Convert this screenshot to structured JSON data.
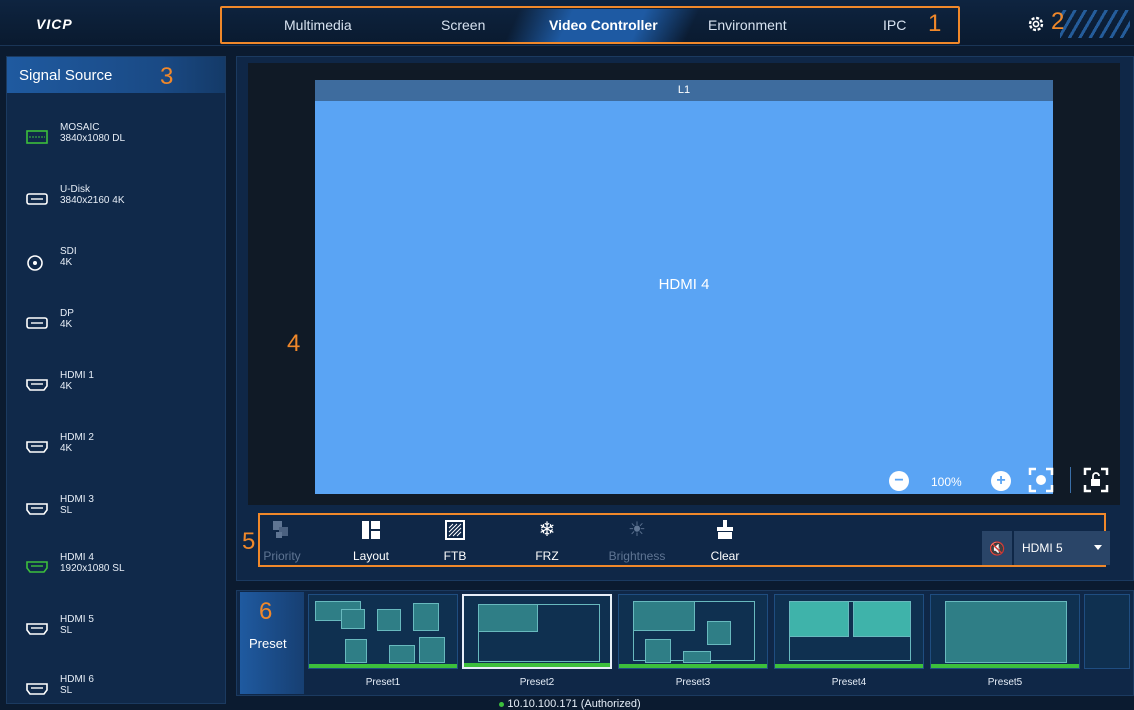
{
  "app": {
    "logo": "VICP"
  },
  "nav": {
    "tabs": [
      {
        "label": "Multimedia"
      },
      {
        "label": "Screen"
      },
      {
        "label": "Video Controller",
        "active": true
      },
      {
        "label": "Environment"
      },
      {
        "label": "IPC"
      }
    ]
  },
  "callouts": {
    "c1": "1",
    "c2": "2",
    "c3": "3",
    "c4": "4",
    "c5": "5",
    "c6": "6"
  },
  "sidebar": {
    "title": "Signal Source",
    "items": [
      {
        "name": "MOSAIC",
        "res": "3840x1080 DL",
        "icon": "mosaic-icon"
      },
      {
        "name": "U-Disk",
        "res": "3840x2160 4K",
        "icon": "usb-disk-icon"
      },
      {
        "name": "SDI",
        "res": "4K",
        "icon": "sdi-icon"
      },
      {
        "name": "DP",
        "res": "4K",
        "icon": "displayport-icon"
      },
      {
        "name": "HDMI 1",
        "res": "4K",
        "icon": "hdmi-icon"
      },
      {
        "name": "HDMI 2",
        "res": "4K",
        "icon": "hdmi-icon"
      },
      {
        "name": "HDMI 3",
        "res": "SL",
        "icon": "hdmi-icon"
      },
      {
        "name": "HDMI 4",
        "res": "1920x1080 SL",
        "icon": "hdmi-icon"
      },
      {
        "name": "HDMI 5",
        "res": "SL",
        "icon": "hdmi-icon"
      },
      {
        "name": "HDMI 6",
        "res": "SL",
        "icon": "hdmi-icon"
      }
    ]
  },
  "canvas": {
    "layer_title": "L1",
    "layer_source": "HDMI 4",
    "zoom": "100%"
  },
  "toolbar": {
    "tools": [
      {
        "label": "Priority",
        "enabled": false,
        "icon": "priority-icon"
      },
      {
        "label": "Layout",
        "enabled": true,
        "icon": "layout-icon"
      },
      {
        "label": "FTB",
        "enabled": true,
        "icon": "ftb-icon"
      },
      {
        "label": "FRZ",
        "enabled": true,
        "icon": "freeze-icon"
      },
      {
        "label": "Brightness",
        "enabled": false,
        "icon": "brightness-icon"
      },
      {
        "label": "Clear",
        "enabled": true,
        "icon": "clear-icon"
      }
    ],
    "audio_source": "HDMI 5"
  },
  "presets": {
    "label": "Preset",
    "items": [
      {
        "name": "Preset1"
      },
      {
        "name": "Preset2",
        "selected": true
      },
      {
        "name": "Preset3"
      },
      {
        "name": "Preset4"
      },
      {
        "name": "Preset5"
      }
    ]
  },
  "status": {
    "text": "10.10.100.171 (Authorized)"
  },
  "colors": {
    "accent": "#f0882a",
    "layer": "#5aa4f4",
    "ok": "#3cbf3c",
    "panel": "#0f2747"
  }
}
